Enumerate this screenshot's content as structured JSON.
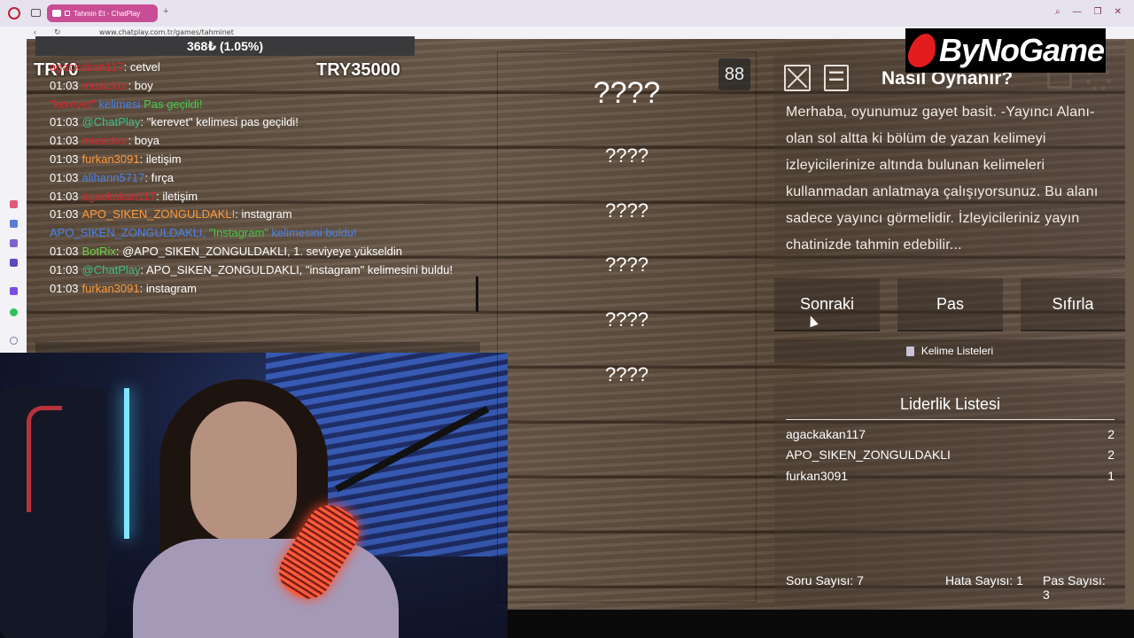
{
  "browser": {
    "tab_title": "Tahmin Et - ChatPlay",
    "tab_new": "+",
    "url": "www.chatplay.com.tr/games/tahminet",
    "controls": [
      "⌕",
      "—",
      "❐",
      "✕"
    ]
  },
  "stats": {
    "progress_text": "368₺ (1.05%)",
    "left_amount": "TRY0",
    "right_amount": "TRY35000"
  },
  "chat": [
    {
      "time": "",
      "user": "agackakan117",
      "user_color": "#d9262c",
      "sep": ": ",
      "msg": "cetvel",
      "msg_color": "#ffffff"
    },
    {
      "time": "01:03",
      "user": "musickor",
      "user_color": "#d9262c",
      "sep": ": ",
      "msg": "boy",
      "msg_color": "#ffffff"
    },
    {
      "time": "",
      "user": "\"kerevet\"",
      "user_color": "#d9262c",
      "sep": " kelimesi ",
      "msg": "Pas geçildi!",
      "msg_color": "#45c84a",
      "sep_color": "#4a83e6"
    },
    {
      "time": "01:03",
      "user": "@ChatPlay",
      "user_color": "#3dbd8b",
      "sep": ": ",
      "msg": "\"kerevet\" kelimesi pas geçildi!",
      "msg_color": "#ffffff"
    },
    {
      "time": "01:03",
      "user": "musickor",
      "user_color": "#d9262c",
      "sep": ": ",
      "msg": "boya",
      "msg_color": "#ffffff"
    },
    {
      "time": "01:03",
      "user": "furkan3091",
      "user_color": "#ff9a3b",
      "sep": ": ",
      "msg": "iletişim",
      "msg_color": "#ffffff"
    },
    {
      "time": "01:03",
      "user": "alihann5717",
      "user_color": "#4a83e6",
      "sep": ": ",
      "msg": "fırça",
      "msg_color": "#ffffff"
    },
    {
      "time": "01:03",
      "user": "agackakan117",
      "user_color": "#d9262c",
      "sep": ": ",
      "msg": "iletişim",
      "msg_color": "#ffffff"
    },
    {
      "time": "01:03",
      "user": "APO_SIKEN_ZONGULDAKLI",
      "user_color": "#ff9a3b",
      "sep": ": ",
      "msg": "instagram",
      "msg_color": "#ffffff"
    },
    {
      "time": "",
      "user": "APO_SIKEN_ZONGULDAKLI, ",
      "user_color": "#4a83e6",
      "sep": "\"Instagram\"",
      "msg": " kelimesini buldu!",
      "msg_color": "#4a83e6",
      "sep_color": "#45c84a"
    },
    {
      "time": "01:03",
      "user": "BotRix",
      "user_color": "#6bd246",
      "sep": ": ",
      "msg": "@APO_SIKEN_ZONGULDAKLI, 1. seviyeye yükseldin",
      "msg_color": "#ffffff"
    },
    {
      "time": "01:03",
      "user": "@ChatPlay",
      "user_color": "#3dbd8b",
      "sep": ": ",
      "msg": "APO_SIKEN_ZONGULDAKLI, \"instagram\" kelimesini buldu!",
      "msg_color": "#ffffff"
    },
    {
      "time": "01:03",
      "user": "furkan3091",
      "user_color": "#ff9a3b",
      "sep": ": ",
      "msg": "instagram",
      "msg_color": "#ffffff"
    }
  ],
  "words": {
    "counter": "88",
    "main": "????",
    "items": [
      "????",
      "????",
      "????",
      "????",
      "????"
    ]
  },
  "howto": {
    "title": "Nasıl Oynanır?",
    "text": "Merhaba, oyunumuz gayet basit. -Yayıncı Alanı- olan sol altta ki bölüm de yazan kelimeyi izleyicilerinize altında bulunan kelimeleri kullanmadan anlatmaya çalışıyorsunuz. Bu alanı sadece yayıncı görmelidir. İzleyicileriniz yayın chatinizde tahmin edebilir..."
  },
  "buttons": {
    "next": "Sonraki",
    "pass": "Pas",
    "reset": "Sıfırla",
    "word_lists": "Kelime Listeleri"
  },
  "leaderboard": {
    "title": "Liderlik Listesi",
    "rows": [
      {
        "name": "agackakan117",
        "score": "2"
      },
      {
        "name": "APO_SIKEN_ZONGULDAKLI",
        "score": "2"
      },
      {
        "name": "furkan3091",
        "score": "1"
      }
    ]
  },
  "footer": {
    "soru": "Soru Sayısı: 7",
    "hata": "Hata Sayısı: 1",
    "pas": "Pas Sayısı: 3"
  },
  "logo": {
    "text": "ByNoGame"
  },
  "colors": {
    "brand_red": "#e31d1d",
    "tab_pink": "#c84d95",
    "wood": "#5d4d3e"
  }
}
